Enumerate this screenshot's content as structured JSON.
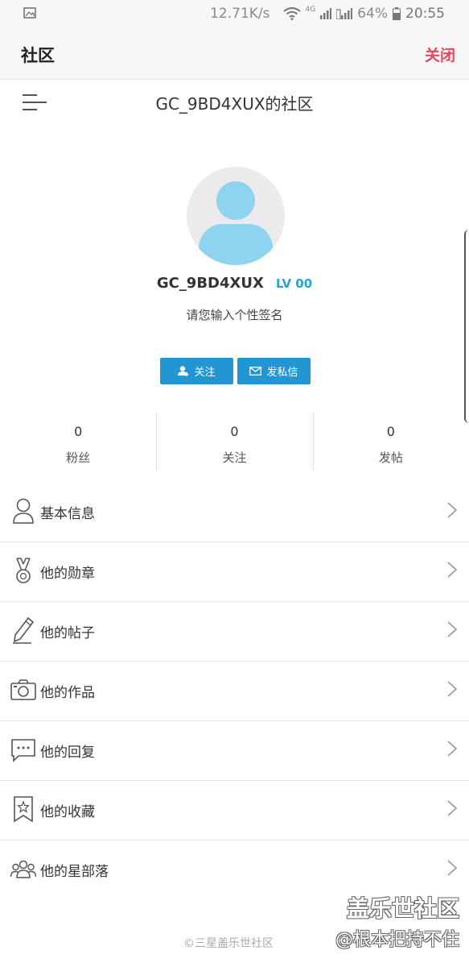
{
  "status_bar": {
    "speed": "12.71K/s",
    "network": "4G",
    "battery": "64%",
    "time": "20:55"
  },
  "header": {
    "title": "社区",
    "close_label": "关闭"
  },
  "community": {
    "title": "GC_9BD4XUX的社区"
  },
  "profile": {
    "username": "GC_9BD4XUX",
    "level": "LV 00",
    "signature": "请您输入个性签名",
    "follow_label": "关注",
    "message_label": "发私信"
  },
  "stats": [
    {
      "value": "0",
      "label": "粉丝"
    },
    {
      "value": "0",
      "label": "关注"
    },
    {
      "value": "0",
      "label": "发帖"
    }
  ],
  "menu": [
    {
      "label": "基本信息",
      "icon": "user-icon"
    },
    {
      "label": "他的勋章",
      "icon": "medal-icon"
    },
    {
      "label": "他的帖子",
      "icon": "pencil-icon"
    },
    {
      "label": "他的作品",
      "icon": "camera-icon"
    },
    {
      "label": "他的回复",
      "icon": "comment-icon"
    },
    {
      "label": "他的收藏",
      "icon": "bookmark-star-icon"
    },
    {
      "label": "他的星部落",
      "icon": "group-icon"
    }
  ],
  "footer": {
    "copyright": "©三星盖乐世社区"
  },
  "watermark": {
    "line1": "盖乐世社区",
    "line2": "@根本把持不住"
  },
  "colors": {
    "accent": "#2196d3",
    "close": "#e8465a",
    "level": "#2aa0cf",
    "avatar": "#8ed3ef"
  }
}
